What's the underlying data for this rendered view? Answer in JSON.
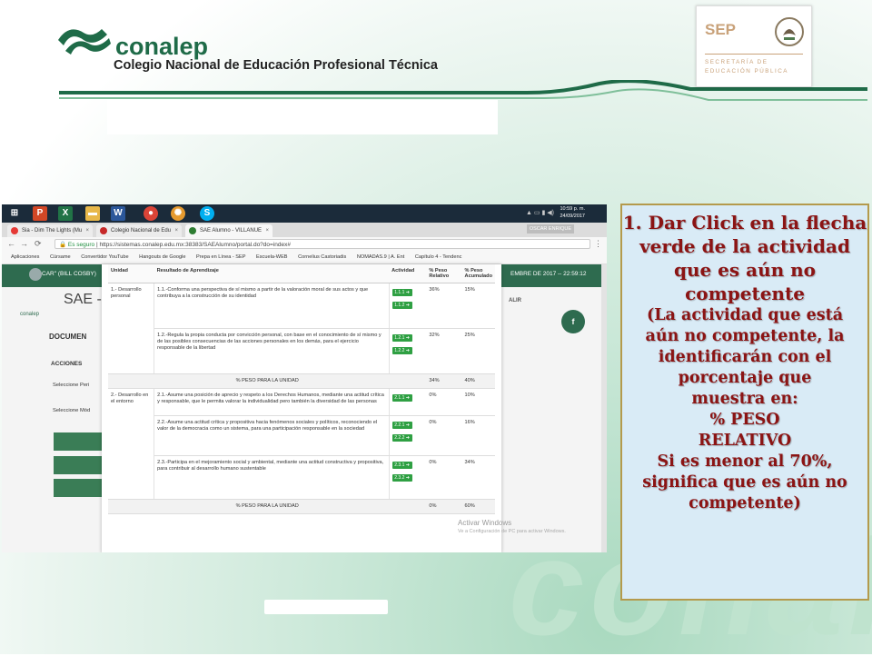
{
  "header": {
    "brand_name": "conalep",
    "brand_subtitle": "Colegio Nacional de Educación Profesional Técnica",
    "sep_title": "SEP",
    "sep_line1": "SECRETARÍA DE",
    "sep_line2": "EDUCACIÓN PÚBLICA"
  },
  "background_watermark": "conal",
  "colors": {
    "brand_green": "#2e6b4f",
    "action_green": "#2fa043",
    "callout_text": "#8b1414",
    "callout_bg": "#d9ebf6"
  },
  "screenshot": {
    "taskbar": {
      "apps": [
        "powerpoint-icon",
        "excel-icon",
        "folder-icon",
        "word-icon",
        "chrome-icon",
        "settings-icon",
        "skype-icon"
      ],
      "time": "10:59 p. m.",
      "date": "24/09/2017"
    },
    "tabs": [
      {
        "label": "Sia - Dim The Lights (Mu",
        "dot": "#e53935"
      },
      {
        "label": "Colegio Nacional de Edu",
        "dot": "#c62828"
      },
      {
        "label": "SAE Alumno - VILLANUE",
        "dot": "#2e7d32"
      }
    ],
    "tab_user": "OSCAR ENRIQUE",
    "address": {
      "secure": "Es seguro",
      "url": "https://sistemas.conalep.edu.mx:38383/SAEAlumno/portal.do?do=index#"
    },
    "bookmarks": [
      "Aplicaciones",
      "Cúrsame",
      "Convertidor YouTube",
      "Hangouts de Google",
      "Prepa en Línea - SEP",
      "Escuela-WEB",
      "Cornelius Castoriadis",
      "NOMADAS.9 | A. Ent",
      "Capítulo 4 - Tendenc"
    ],
    "page": {
      "user": "CAR\" (BILL COSBY)",
      "date": "EMBRE DE 2017 -- 22:59:12",
      "sae_logo": "conalep",
      "sae_title": "SAE -",
      "salir": "ALIR",
      "social": "f",
      "doc": "DOCUMEN",
      "acciones": "ACCIONES",
      "selecc1": "Seleccione Peri",
      "selecc2": "Seleccione Mód"
    },
    "table": {
      "headers": [
        "Unidad",
        "Resultado de Aprendizaje",
        "Actividad",
        "% Peso Relativo",
        "% Peso Acumulado"
      ],
      "rows": [
        {
          "unidad": "1.- Desarrollo personal",
          "resultado": "1.1.-Conforma una perspectiva de sí mismo a partir de la valoración moral de sus actos y que contribuya a la construcción de su identidad",
          "acts": [
            "1.1.1 ➜",
            "1.1.2 ➜"
          ],
          "rel": "36%",
          "acum": "15%"
        },
        {
          "unidad": "",
          "resultado": "1.2.-Regula la propia conducta por convicción personal, con base en el conocimiento de sí mismo y de las posibles consecuencias de las acciones personales en los demás, para el ejercicio responsable de la libertad",
          "acts": [
            "1.2.1 ➜",
            "1.2.2 ➜"
          ],
          "rel": "32%",
          "acum": "25%"
        },
        {
          "peso": true,
          "label": "% PESO PARA LA UNIDAD",
          "rel": "34%",
          "acum": "40%"
        },
        {
          "unidad": "2.- Desarrollo en el entorno",
          "resultado": "2.1.-Asume una posición de aprecio y respeto a los Derechos Humanos, mediante una actitud crítica y responsable, que le permita valorar la individualidad pero también la diversidad de las personas",
          "acts": [
            "2.1.1 ➜"
          ],
          "rel": "0%",
          "acum": "10%"
        },
        {
          "unidad": "",
          "resultado": "2.2.-Asume una actitud crítica y propositiva hacia fenómenos sociales y políticos, reconociendo el valor de la democracia como un sistema, para una participación responsable en la sociedad",
          "acts": [
            "2.2.1 ➜",
            "2.2.2 ➜"
          ],
          "rel": "0%",
          "acum": "16%"
        },
        {
          "unidad": "",
          "resultado": "2.3.-Participa en el mejoramiento social y ambiental, mediante una actitud constructiva y propositiva, para contribuir al desarrollo humano sustentable",
          "acts": [
            "2.3.1 ➜",
            "2.3.2 ➜"
          ],
          "rel": "0%",
          "acum": "34%"
        },
        {
          "peso": true,
          "label": "% PESO PARA LA UNIDAD",
          "rel": "0%",
          "acum": "60%"
        }
      ]
    },
    "activar_title": "Activar Windows",
    "activar_sub": "Ve a Configuración de PC para activar Windows."
  },
  "callout": {
    "main": "1. Dar Click en la flecha verde de la actividad que es aún no competente",
    "lines": [
      "(La actividad que está",
      "aún no competente, la",
      "identificarán con el",
      "porcentaje que",
      "muestra en:",
      "% PESO",
      "RELATIVO",
      "Si es menor al 70%,",
      "significa que es aún no",
      "competente)"
    ]
  }
}
